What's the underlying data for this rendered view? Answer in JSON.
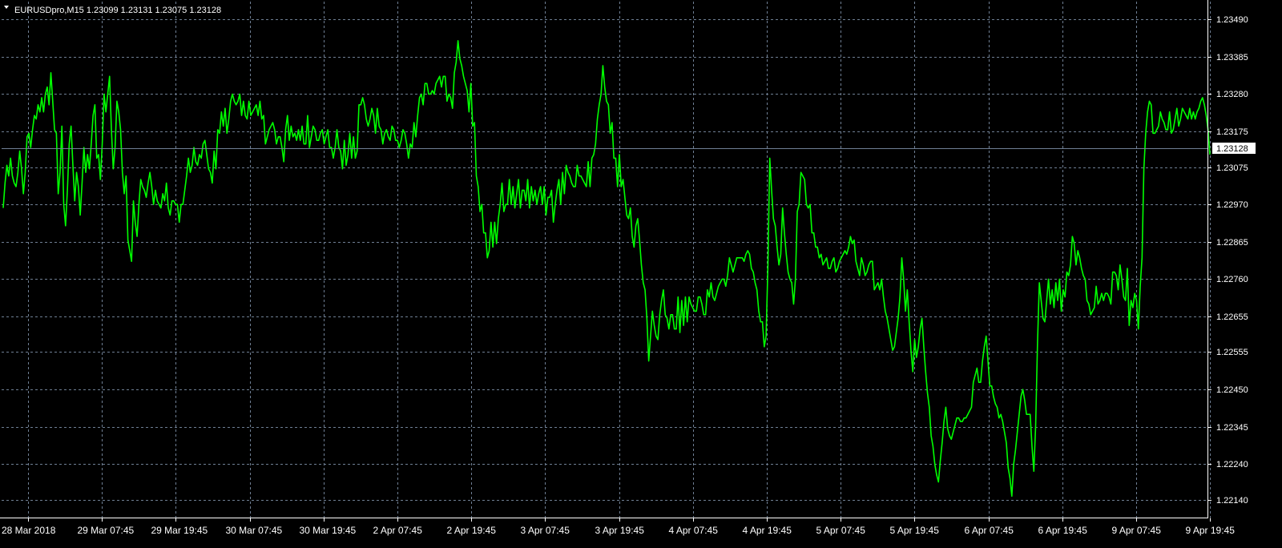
{
  "header": {
    "title": "EURUSDpro,M15  1.23099 1.23131 1.23075 1.23128",
    "menu_icon": "triangle-down-icon"
  },
  "colors": {
    "background": "#000000",
    "grid": "#6f7f94",
    "series": "#00ff00",
    "price_line": "#6f7f94",
    "axis": "#ffffff",
    "text": "#ffffff",
    "price_tag_bg": "#ffffff",
    "price_tag_text": "#000000"
  },
  "chart_data": {
    "type": "line",
    "title": "EURUSDpro,M15  1.23099 1.23131 1.23075 1.23128",
    "subtitle": "",
    "xlabel": "",
    "ylabel": "",
    "grid": true,
    "legend": "none",
    "ylim": [
      1.2209,
      1.2354
    ],
    "y_ticks": [
      "1.23490",
      "1.23385",
      "1.23280",
      "1.23175",
      "1.23075",
      "1.22970",
      "1.22865",
      "1.22760",
      "1.22655",
      "1.22555",
      "1.22450",
      "1.22345",
      "1.22240",
      "1.22140"
    ],
    "x_ticks": [
      "28 Mar 2018",
      "29 Mar 07:45",
      "29 Mar 19:45",
      "30 Mar 07:45",
      "30 Mar 19:45",
      "2 Apr 07:45",
      "2 Apr 19:45",
      "3 Apr 07:45",
      "3 Apr 19:45",
      "4 Apr 07:45",
      "4 Apr 19:45",
      "5 Apr 07:45",
      "5 Apr 19:45",
      "6 Apr 07:45",
      "6 Apr 19:45",
      "9 Apr 07:45",
      "9 Apr 19:45"
    ],
    "current_price": "1.23128",
    "series": [
      {
        "values": [
          1.2296,
          1.2303,
          1.2308,
          1.2305,
          1.231,
          1.2305,
          1.2303,
          1.2302,
          1.2306,
          1.2312,
          1.2307,
          1.23,
          1.2306,
          1.2316,
          1.2317,
          1.2313,
          1.2318,
          1.2322,
          1.2321,
          1.2325,
          1.2323,
          1.2327,
          1.2323,
          1.2328,
          1.233,
          1.2325,
          1.2334,
          1.2326,
          1.2318,
          1.2317,
          1.23,
          1.2306,
          1.2319,
          1.2297,
          1.2291,
          1.2301,
          1.2314,
          1.2319,
          1.2308,
          1.2298,
          1.2306,
          1.2302,
          1.2294,
          1.2303,
          1.2313,
          1.2306,
          1.2311,
          1.2307,
          1.2314,
          1.2322,
          1.2325,
          1.231,
          1.2311,
          1.2304,
          1.2314,
          1.2328,
          1.2323,
          1.2328,
          1.2333,
          1.2318,
          1.2307,
          1.2313,
          1.2326,
          1.2323,
          1.2318,
          1.2306,
          1.23,
          1.2305,
          1.2287,
          1.2284,
          1.2281,
          1.2298,
          1.2292,
          1.2288,
          1.2297,
          1.2304,
          1.2302,
          1.2301,
          1.2299,
          1.2303,
          1.2306,
          1.2302,
          1.2297,
          1.2301,
          1.2298,
          1.2297,
          1.2296,
          1.23,
          1.2298,
          1.2303,
          1.2296,
          1.2294,
          1.2298,
          1.2298,
          1.2297,
          1.2297,
          1.2292,
          1.2297,
          1.2297,
          1.2301,
          1.2305,
          1.231,
          1.2306,
          1.2308,
          1.2313,
          1.2309,
          1.2308,
          1.2311,
          1.231,
          1.2314,
          1.2315,
          1.2311,
          1.2307,
          1.2306,
          1.2303,
          1.2312,
          1.2307,
          1.2318,
          1.2317,
          1.2323,
          1.2319,
          1.2324,
          1.2317,
          1.2321,
          1.2326,
          1.2328,
          1.2326,
          1.2325,
          1.2326,
          1.2328,
          1.2322,
          1.2326,
          1.2322,
          1.2321,
          1.2326,
          1.2322,
          1.2323,
          1.2324,
          1.2325,
          1.2322,
          1.2326,
          1.2321,
          1.2322,
          1.2314,
          1.2316,
          1.2318,
          1.2319,
          1.232,
          1.2318,
          1.2314,
          1.2316,
          1.2316,
          1.2313,
          1.2309,
          1.2318,
          1.2322,
          1.2315,
          1.2319,
          1.2316,
          1.2317,
          1.2315,
          1.2318,
          1.2315,
          1.2319,
          1.2314,
          1.2314,
          1.2322,
          1.2313,
          1.2316,
          1.2319,
          1.2318,
          1.2315,
          1.2315,
          1.2317,
          1.2318,
          1.2314,
          1.2316,
          1.2318,
          1.2313,
          1.2313,
          1.231,
          1.2313,
          1.2318,
          1.2313,
          1.2312,
          1.2307,
          1.2315,
          1.2308,
          1.2311,
          1.2317,
          1.231,
          1.2316,
          1.231,
          1.2312,
          1.2325,
          1.2325,
          1.2327,
          1.2325,
          1.2321,
          1.2319,
          1.2321,
          1.2324,
          1.2322,
          1.2317,
          1.2324,
          1.2319,
          1.2318,
          1.2314,
          1.2317,
          1.2318,
          1.2316,
          1.2315,
          1.2319,
          1.2318,
          1.2315,
          1.2315,
          1.2313,
          1.2315,
          1.2318,
          1.2317,
          1.2314,
          1.231,
          1.2314,
          1.2313,
          1.232,
          1.2316,
          1.2322,
          1.2327,
          1.2328,
          1.2325,
          1.2331,
          1.2331,
          1.2328,
          1.2328,
          1.2329,
          1.2328,
          1.2331,
          1.2332,
          1.2333,
          1.233,
          1.2333,
          1.2333,
          1.2326,
          1.2328,
          1.2327,
          1.2324,
          1.2334,
          1.2337,
          1.2343,
          1.2338,
          1.2336,
          1.2333,
          1.2331,
          1.2329,
          1.2323,
          1.2331,
          1.2319,
          1.232,
          1.2305,
          1.2302,
          1.2295,
          1.2297,
          1.2289,
          1.2289,
          1.2282,
          1.2284,
          1.2292,
          1.2285,
          1.2292,
          1.2286,
          1.2293,
          1.2297,
          1.2303,
          1.2295,
          1.2297,
          1.2297,
          1.2304,
          1.2297,
          1.2302,
          1.2296,
          1.23,
          1.2304,
          1.2296,
          1.2301,
          1.2301,
          1.2298,
          1.2304,
          1.2296,
          1.2302,
          1.2298,
          1.2301,
          1.2297,
          1.23,
          1.2302,
          1.2297,
          1.2302,
          1.2294,
          1.2299,
          1.2299,
          1.2301,
          1.2292,
          1.2297,
          1.2301,
          1.2304,
          1.2297,
          1.2306,
          1.23,
          1.2308,
          1.2306,
          1.2305,
          1.2303,
          1.2302,
          1.2302,
          1.2308,
          1.2305,
          1.2305,
          1.2304,
          1.2303,
          1.2302,
          1.2309,
          1.2302,
          1.231,
          1.2311,
          1.2314,
          1.2321,
          1.2325,
          1.2328,
          1.2336,
          1.233,
          1.2326,
          1.2325,
          1.2317,
          1.232,
          1.231,
          1.231,
          1.2302,
          1.2311,
          1.2302,
          1.2304,
          1.2299,
          1.2294,
          1.2293,
          1.2296,
          1.2288,
          1.2285,
          1.2291,
          1.2293,
          1.2287,
          1.228,
          1.2275,
          1.2273,
          1.2265,
          1.2253,
          1.226,
          1.2267,
          1.2263,
          1.226,
          1.2259,
          1.2266,
          1.227,
          1.2273,
          1.2266,
          1.2265,
          1.2262,
          1.2266,
          1.2266,
          1.2262,
          1.2262,
          1.2271,
          1.2261,
          1.227,
          1.2263,
          1.2271,
          1.2264,
          1.2271,
          1.2269,
          1.2268,
          1.2267,
          1.2267,
          1.2271,
          1.2271,
          1.2269,
          1.2266,
          1.2266,
          1.2273,
          1.2271,
          1.2275,
          1.2271,
          1.227,
          1.2272,
          1.2274,
          1.2275,
          1.2276,
          1.2276,
          1.2274,
          1.2277,
          1.2282,
          1.228,
          1.2278,
          1.228,
          1.2282,
          1.2282,
          1.2282,
          1.2282,
          1.2281,
          1.2283,
          1.2284,
          1.2283,
          1.2279,
          1.2278,
          1.2275,
          1.2273,
          1.2267,
          1.2264,
          1.2264,
          1.2257,
          1.226,
          1.228,
          1.231,
          1.2301,
          1.2293,
          1.2291,
          1.2285,
          1.228,
          1.2283,
          1.2296,
          1.2289,
          1.2283,
          1.2278,
          1.2276,
          1.2275,
          1.2269,
          1.2276,
          1.2295,
          1.2297,
          1.2306,
          1.2305,
          1.2304,
          1.2297,
          1.2296,
          1.2297,
          1.2289,
          1.2289,
          1.2285,
          1.2285,
          1.2282,
          1.2283,
          1.228,
          1.2281,
          1.2282,
          1.2279,
          1.2279,
          1.2281,
          1.2282,
          1.2278,
          1.2279,
          1.2281,
          1.2282,
          1.2283,
          1.2284,
          1.2283,
          1.2285,
          1.2288,
          1.2286,
          1.2287,
          1.2281,
          1.2279,
          1.2277,
          1.2282,
          1.228,
          1.2277,
          1.2278,
          1.228,
          1.2281,
          1.2281,
          1.2273,
          1.2274,
          1.2275,
          1.2273,
          1.2276,
          1.2271,
          1.2267,
          1.2265,
          1.2262,
          1.2259,
          1.2256,
          1.2257,
          1.2261,
          1.2265,
          1.2271,
          1.2282,
          1.2276,
          1.2267,
          1.2273,
          1.2264,
          1.2256,
          1.225,
          1.2259,
          1.2254,
          1.2257,
          1.2262,
          1.2265,
          1.2257,
          1.225,
          1.2244,
          1.224,
          1.2232,
          1.2229,
          1.2224,
          1.2221,
          1.2219,
          1.2225,
          1.223,
          1.2236,
          1.224,
          1.2234,
          1.2232,
          1.2231,
          1.2233,
          1.2235,
          1.2237,
          1.2237,
          1.2236,
          1.2236,
          1.2237,
          1.2237,
          1.2238,
          1.2239,
          1.224,
          1.2247,
          1.2249,
          1.2251,
          1.2247,
          1.2247,
          1.2253,
          1.2257,
          1.226,
          1.2253,
          1.2246,
          1.2246,
          1.2243,
          1.2241,
          1.224,
          1.2237,
          1.2238,
          1.2236,
          1.2233,
          1.223,
          1.2223,
          1.222,
          1.2215,
          1.2224,
          1.2228,
          1.2233,
          1.2238,
          1.2243,
          1.2245,
          1.2242,
          1.2238,
          1.2238,
          1.2238,
          1.2229,
          1.2222,
          1.2235,
          1.2258,
          1.2275,
          1.227,
          1.2265,
          1.2264,
          1.227,
          1.2276,
          1.2269,
          1.2273,
          1.2268,
          1.2275,
          1.227,
          1.2276,
          1.2267,
          1.2273,
          1.2271,
          1.2278,
          1.2277,
          1.228,
          1.2288,
          1.2286,
          1.228,
          1.2284,
          1.2282,
          1.2279,
          1.2277,
          1.2276,
          1.227,
          1.2269,
          1.2266,
          1.2267,
          1.2268,
          1.2274,
          1.2269,
          1.227,
          1.2272,
          1.227,
          1.2272,
          1.2272,
          1.2271,
          1.2269,
          1.2278,
          1.2278,
          1.2277,
          1.2273,
          1.228,
          1.2276,
          1.2271,
          1.227,
          1.2279,
          1.2263,
          1.227,
          1.2268,
          1.2272,
          1.227,
          1.2262,
          1.2274,
          1.2282,
          1.2307,
          1.2317,
          1.2323,
          1.2326,
          1.2325,
          1.2317,
          1.2317,
          1.2318,
          1.2319,
          1.2323,
          1.2321,
          1.232,
          1.2318,
          1.2318,
          1.2323,
          1.2317,
          1.2318,
          1.2321,
          1.2324,
          1.2319,
          1.2321,
          1.2324,
          1.2323,
          1.2322,
          1.2321,
          1.2324,
          1.2321,
          1.2323,
          1.2321,
          1.2323,
          1.2324,
          1.2326,
          1.2327,
          1.2325,
          1.2322,
          1.2318,
          1.2311
        ]
      }
    ]
  }
}
